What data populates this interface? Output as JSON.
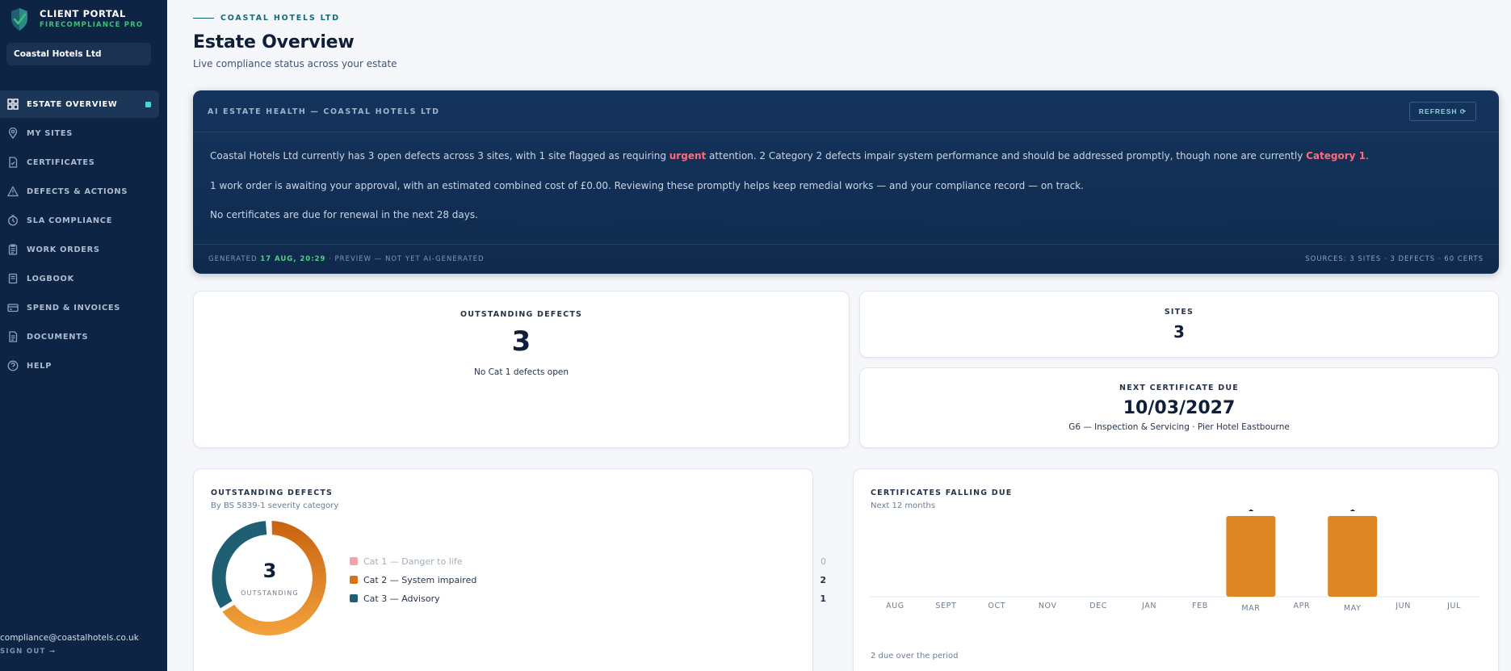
{
  "sidebar": {
    "brand_title": "CLIENT PORTAL",
    "brand_sub": "FIRECOMPLIANCE PRO",
    "client": "Coastal Hotels Ltd",
    "items": [
      {
        "label": "ESTATE OVERVIEW",
        "icon": "grid-icon"
      },
      {
        "label": "MY SITES",
        "icon": "map-pin-icon"
      },
      {
        "label": "CERTIFICATES",
        "icon": "certificate-icon"
      },
      {
        "label": "DEFECTS & ACTIONS",
        "icon": "warning-icon"
      },
      {
        "label": "SLA COMPLIANCE",
        "icon": "clock-icon"
      },
      {
        "label": "WORK ORDERS",
        "icon": "clipboard-icon"
      },
      {
        "label": "LOGBOOK",
        "icon": "book-icon"
      },
      {
        "label": "SPEND & INVOICES",
        "icon": "card-icon"
      },
      {
        "label": "DOCUMENTS",
        "icon": "document-icon"
      },
      {
        "label": "HELP",
        "icon": "help-icon"
      }
    ],
    "email": "compliance@coastalhotels.co.uk",
    "signout": "SIGN OUT →"
  },
  "header": {
    "eyebrow": "COASTAL HOTELS LTD",
    "title": "Estate Overview",
    "subtitle": "Live compliance status across your estate"
  },
  "ai": {
    "heading": "AI ESTATE HEALTH — COASTAL HOTELS LTD",
    "refresh": "REFRESH ⟳",
    "p1_a": "Coastal Hotels Ltd currently has 3 open defects across 3 sites, with 1 site flagged as requiring ",
    "p1_hl1": "urgent",
    "p1_b": " attention. 2 Category 2 defects impair system performance and should be addressed promptly, though none are currently ",
    "p1_hl2": "Category 1",
    "p1_c": ".",
    "p2": "1 work order is awaiting your approval, with an estimated combined cost of £0.00. Reviewing these promptly helps keep remedial works — and your compliance record — on track.",
    "p3": "No certificates are due for renewal in the next 28 days.",
    "foot_generated": "GENERATED",
    "foot_time": "17 AUG, 20:29",
    "foot_preview": "· PREVIEW — NOT YET AI-GENERATED",
    "foot_sources": "SOURCES: 3 SITES · 3 DEFECTS · 60 CERTS"
  },
  "kpis": {
    "defects_label": "OUTSTANDING DEFECTS",
    "defects_value": "3",
    "defects_sub": "No Cat 1 defects open",
    "sites_label": "SITES",
    "sites_value": "3",
    "cert_label": "NEXT CERTIFICATE DUE",
    "cert_value": "10/03/2027",
    "cert_sub": "G6 — Inspection & Servicing · Pier Hotel Eastbourne"
  },
  "defects_panel": {
    "title": "OUTSTANDING DEFECTS",
    "subtitle": "By BS 5839-1 severity category",
    "total": "3",
    "total_label": "OUTSTANDING",
    "legend": [
      {
        "label": "Cat 1 — Danger to life",
        "value": "0",
        "color": "#f2a3ab"
      },
      {
        "label": "Cat 2 — System impaired",
        "value": "2",
        "color": "#d9731a"
      },
      {
        "label": "Cat 3 — Advisory",
        "value": "1",
        "color": "#1f5f73"
      }
    ]
  },
  "certs_panel": {
    "title": "CERTIFICATES FALLING DUE",
    "subtitle": "Next 12 months",
    "footer": "2 due over the period"
  },
  "chart_data": {
    "type": "bar",
    "title": "CERTIFICATES FALLING DUE",
    "subtitle": "Next 12 months",
    "categories": [
      "AUG",
      "SEPT",
      "OCT",
      "NOV",
      "DEC",
      "JAN",
      "FEB",
      "MAR",
      "APR",
      "MAY",
      "JUN",
      "JUL"
    ],
    "values": [
      0,
      0,
      0,
      0,
      0,
      0,
      0,
      1,
      0,
      1,
      0,
      0
    ],
    "data_labels": [
      "",
      "",
      "",
      "",
      "",
      "",
      "",
      "1",
      "",
      "1",
      "",
      ""
    ],
    "ylim": [
      0,
      1
    ],
    "bar_color": "#dd8623",
    "grid": false
  },
  "colors": {
    "sidebar_bg": "#0d2444",
    "accent_teal": "#4fd1d9",
    "accent_green": "#3fc07a",
    "urgent_red": "#ff6b78"
  }
}
